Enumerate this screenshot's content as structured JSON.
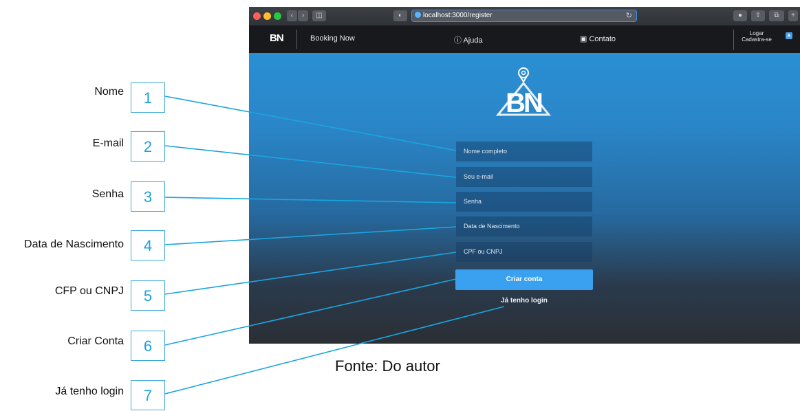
{
  "annotations": [
    {
      "label": "Nome",
      "number": "1"
    },
    {
      "label": "E-mail",
      "number": "2"
    },
    {
      "label": "Senha",
      "number": "3"
    },
    {
      "label": "Data de Nascimento",
      "number": "4"
    },
    {
      "label": "CFP ou CNPJ",
      "number": "5"
    },
    {
      "label": "Criar Conta",
      "number": "6"
    },
    {
      "label": "Já tenho login",
      "number": "7"
    }
  ],
  "caption": "Fonte: Do autor",
  "browser": {
    "url": "localhost:3000/register",
    "sidebar_icon": "sidebar-icon",
    "back_icon": "chevron-left-icon",
    "forward_icon": "chevron-right-icon"
  },
  "navbar": {
    "logo": "BN",
    "brand": "Booking Now",
    "help": "Ajuda",
    "contact": "Contato",
    "login": "Logar",
    "register": "Cadastra-se"
  },
  "form": {
    "logo": "BN",
    "name_placeholder": "Nome completo",
    "email_placeholder": "Seu e-mail",
    "password_placeholder": "Senha",
    "birthdate_placeholder": "Data de Nascimento",
    "doc_placeholder": "CPF ou CNPJ",
    "submit": "Criar conta",
    "login_link": "Já tenho login"
  },
  "colors": {
    "accent": "#3aa0f0",
    "annotation": "#1ea0dc"
  }
}
